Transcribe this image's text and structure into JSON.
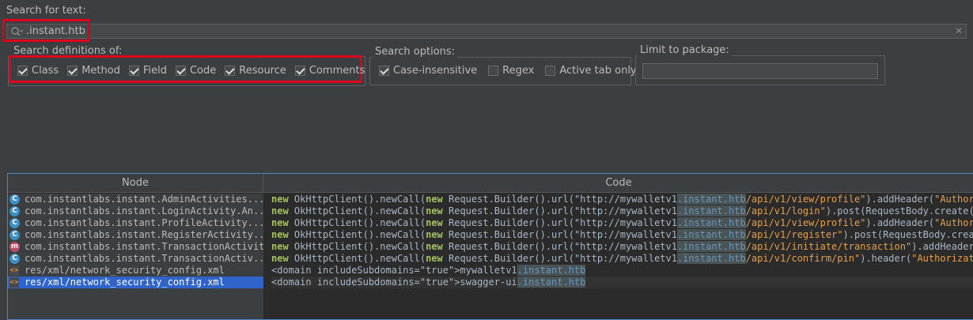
{
  "search": {
    "label": "Search for text:",
    "value": ".instant.htb"
  },
  "definitions": {
    "title": "Search definitions of:",
    "options": [
      {
        "label": "Class",
        "checked": true
      },
      {
        "label": "Method",
        "checked": true
      },
      {
        "label": "Field",
        "checked": true
      },
      {
        "label": "Code",
        "checked": true
      },
      {
        "label": "Resource",
        "checked": true
      },
      {
        "label": "Comments",
        "checked": true
      }
    ]
  },
  "search_options": {
    "title": "Search options:",
    "options": [
      {
        "label": "Case-insensitive",
        "checked": true
      },
      {
        "label": "Regex",
        "checked": false
      },
      {
        "label": "Active tab only",
        "checked": false
      }
    ]
  },
  "package": {
    "title": "Limit to package:",
    "value": ""
  },
  "table": {
    "headers": {
      "node": "Node",
      "code": "Code"
    },
    "rows": [
      {
        "icon": "class-icon",
        "node": "com.instantlabs.instant.AdminActivities....",
        "code": [
          [
            "new",
            "kw2"
          ],
          [
            " OkHttpClient().newCall(",
            ""
          ],
          [
            "new",
            "kw2"
          ],
          [
            " Request.Builder().url(",
            ""
          ],
          [
            "\"http://mywalletv1",
            ""
          ],
          [
            ".instant.htb",
            "hl"
          ],
          [
            "/api/v1/view/profile\"",
            "str"
          ],
          [
            ").addHeader(",
            ""
          ],
          [
            "\"Authorizat",
            "str"
          ]
        ]
      },
      {
        "icon": "class-icon",
        "node": "com.instantlabs.instant.LoginActivity.An...",
        "code": [
          [
            "new",
            "kw2"
          ],
          [
            " OkHttpClient().newCall(",
            ""
          ],
          [
            "new",
            "kw2"
          ],
          [
            " Request.Builder().url(",
            ""
          ],
          [
            "\"http://mywalletv1",
            ""
          ],
          [
            ".instant.htb",
            "hl"
          ],
          [
            "/api/v1/login\"",
            "str"
          ],
          [
            ").post(RequestBody.create(Medi",
            ""
          ]
        ]
      },
      {
        "icon": "class-icon",
        "node": "com.instantlabs.instant.ProfileActivity....",
        "code": [
          [
            "new",
            "kw2"
          ],
          [
            " OkHttpClient().newCall(",
            ""
          ],
          [
            "new",
            "kw2"
          ],
          [
            " Request.Builder().url(",
            ""
          ],
          [
            "\"http://mywalletv1",
            ""
          ],
          [
            ".instant.htb",
            "hl"
          ],
          [
            "/api/v1/view/profile\"",
            "str"
          ],
          [
            ").addHeader(",
            ""
          ],
          [
            "\"Authorizat",
            "str"
          ]
        ]
      },
      {
        "icon": "class-icon",
        "node": "com.instantlabs.instant.RegisterActivity...",
        "code": [
          [
            "new",
            "kw2"
          ],
          [
            " OkHttpClient().newCall(",
            ""
          ],
          [
            "new",
            "kw2"
          ],
          [
            " Request.Builder().url(",
            ""
          ],
          [
            "\"http://mywalletv1",
            ""
          ],
          [
            ".instant.htb",
            "hl"
          ],
          [
            "/api/v1/register\"",
            "str"
          ],
          [
            ").post(RequestBody.create(M",
            ""
          ]
        ]
      },
      {
        "icon": "method-icon",
        "node": "com.instantlabs.instant.TransactionActivity",
        "code": [
          [
            "new",
            "kw2"
          ],
          [
            " OkHttpClient().newCall(",
            ""
          ],
          [
            "new",
            "kw2"
          ],
          [
            " Request.Builder().url(",
            ""
          ],
          [
            "\"http://mywalletv1",
            ""
          ],
          [
            ".instant.htb",
            "hl"
          ],
          [
            "/api/v1/initiate/transaction\"",
            "str"
          ],
          [
            ").addHeader(",
            ""
          ],
          [
            "\"Au",
            "str"
          ]
        ]
      },
      {
        "icon": "class-icon",
        "node": "com.instantlabs.instant.TransactionActiv...",
        "code": [
          [
            "new",
            "kw2"
          ],
          [
            " OkHttpClient().newCall(",
            ""
          ],
          [
            "new",
            "kw2"
          ],
          [
            " Request.Builder().url(",
            ""
          ],
          [
            "\"http://mywalletv1",
            ""
          ],
          [
            ".instant.htb",
            "hl"
          ],
          [
            "/api/v1/confirm/pin\"",
            "str"
          ],
          [
            ").header(",
            ""
          ],
          [
            "\"Authorization\"",
            "str"
          ]
        ]
      },
      {
        "icon": "xml-icon",
        "node": "res/xml/network_security_config.xml",
        "code": [
          [
            "<domain includeSubdomains=\"true\">mywalletv1",
            "xml"
          ],
          [
            ".instant.htb",
            "hl"
          ]
        ]
      },
      {
        "icon": "xml-icon",
        "node": "res/xml/network_security_config.xml",
        "selected": true,
        "code": [
          [
            "<domain includeSubdomains=\"true\">swagger-ui",
            "xml"
          ],
          [
            ".instant.htb",
            "hl"
          ]
        ]
      }
    ]
  },
  "colors": {
    "background": "#3c3f41",
    "selection": "#2f65ca",
    "highlight_box": "#e0001b",
    "focus_border": "#4a88c7"
  }
}
